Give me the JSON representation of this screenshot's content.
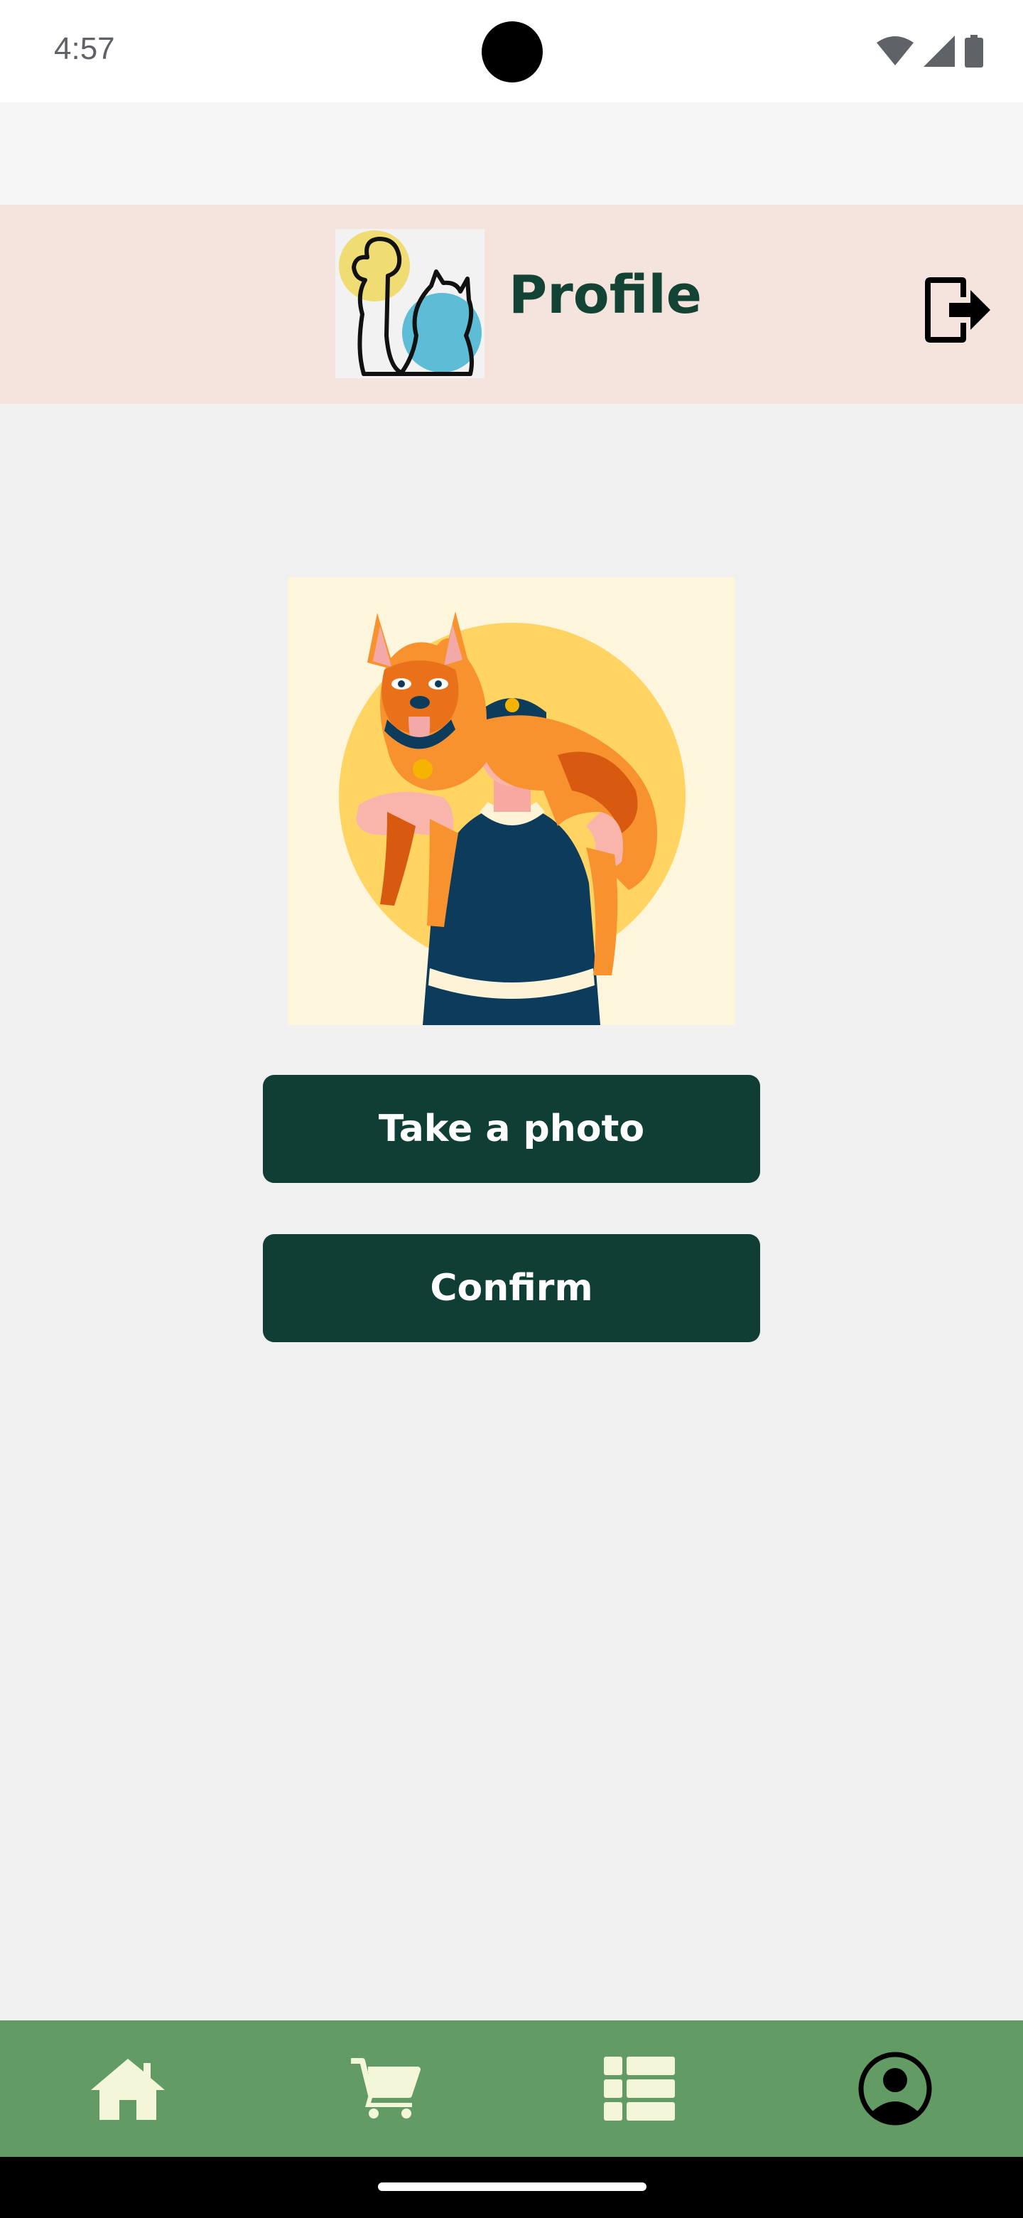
{
  "status_bar": {
    "time": "4:57",
    "icons": [
      "wifi-icon",
      "signal-icon",
      "battery-icon"
    ]
  },
  "header": {
    "title": "Profile",
    "logo": "dog-cat-logo",
    "logout_icon": "logout-icon"
  },
  "profile_photo": {
    "illustration": "man-carrying-dog"
  },
  "actions": {
    "take_photo_label": "Take a photo",
    "confirm_label": "Confirm"
  },
  "bottom_nav": {
    "items": [
      {
        "icon": "home-icon",
        "active": false
      },
      {
        "icon": "cart-icon",
        "active": false
      },
      {
        "icon": "list-icon",
        "active": false
      },
      {
        "icon": "profile-icon",
        "active": true
      }
    ]
  },
  "colors": {
    "header_bg": "#f5e4dd",
    "title": "#134334",
    "button_bg": "#0f3f34",
    "nav_bg": "#639b65",
    "nav_icon": "#f3f6d8",
    "page_bg": "#f0f0f0"
  }
}
